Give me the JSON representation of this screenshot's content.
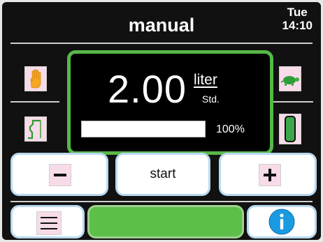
{
  "header": {
    "mode_title": "manual",
    "day": "Tue",
    "time": "14:10"
  },
  "display": {
    "value": "2.00",
    "unit_top": "liter",
    "unit_bottom": "Std.",
    "progress_label": "100%",
    "progress_fraction": 1.0
  },
  "controls": {
    "start_label": "start"
  },
  "icons": {
    "manual_mode": "hand-icon",
    "speed": "turtle-icon",
    "profile": "ramp-profile-icon",
    "level": "green-bar-icon",
    "decrease": "minus-icon",
    "increase": "plus-icon",
    "menu": "menu-icon",
    "info": "info-icon"
  },
  "colors": {
    "accent_green": "#56b848",
    "button_pink": "#f7dbe8",
    "info_blue": "#1a9ae0",
    "status_green": "#5cbf4a"
  }
}
